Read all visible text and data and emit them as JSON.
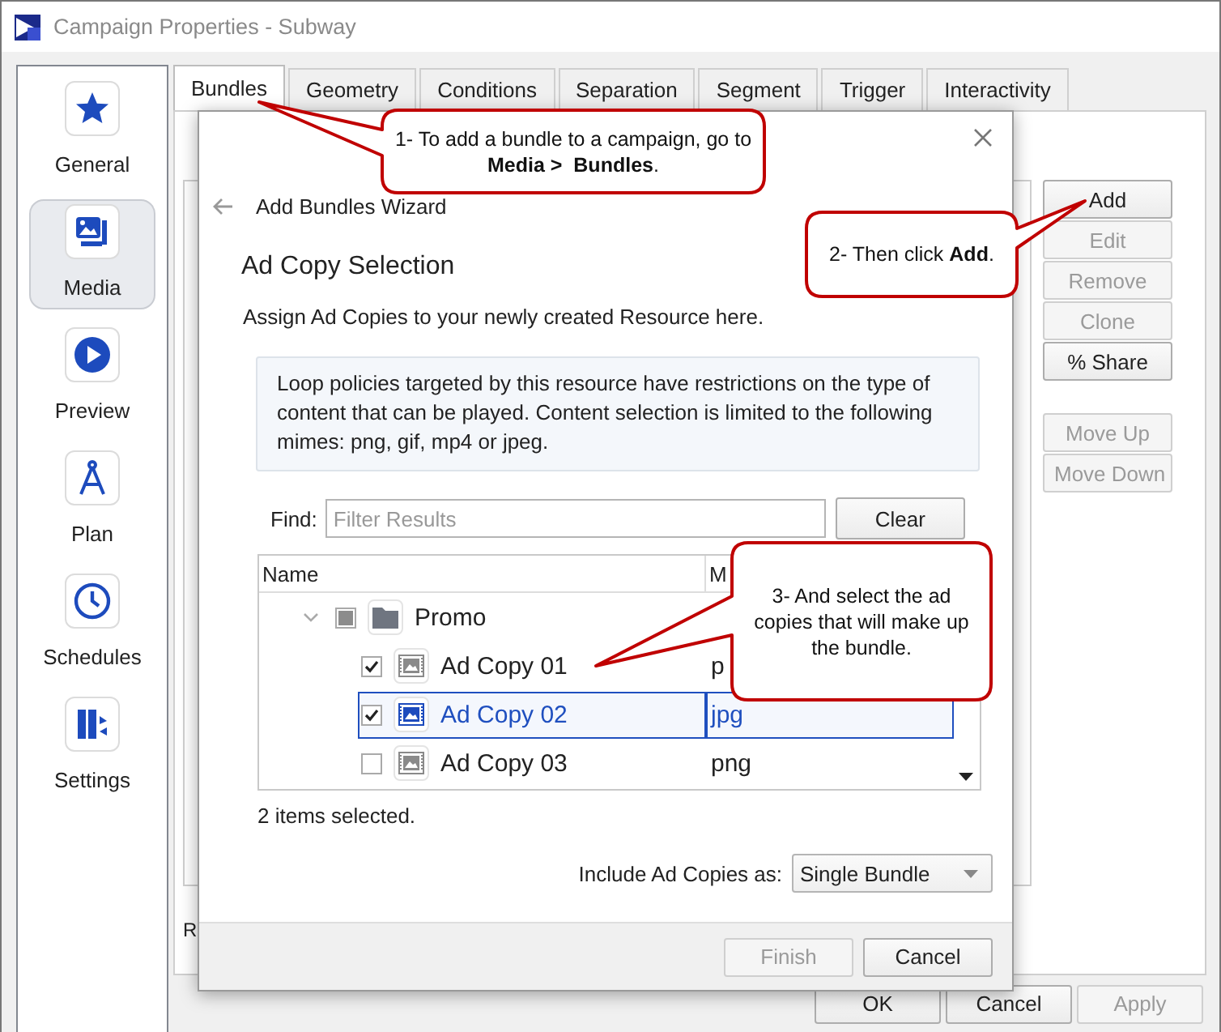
{
  "window": {
    "title": "Campaign Properties - Subway"
  },
  "sidebar": {
    "items": [
      {
        "label": "General",
        "selected": false
      },
      {
        "label": "Media",
        "selected": true
      },
      {
        "label": "Preview",
        "selected": false
      },
      {
        "label": "Plan",
        "selected": false
      },
      {
        "label": "Schedules",
        "selected": false
      },
      {
        "label": "Settings",
        "selected": false
      }
    ]
  },
  "tabs": [
    {
      "label": "Bundles",
      "selected": true
    },
    {
      "label": "Geometry",
      "selected": false
    },
    {
      "label": "Conditions",
      "selected": false
    },
    {
      "label": "Separation",
      "selected": false
    },
    {
      "label": "Segment",
      "selected": false
    },
    {
      "label": "Trigger",
      "selected": false
    },
    {
      "label": "Interactivity",
      "selected": false
    }
  ],
  "panel": {
    "label_fragment": "R"
  },
  "side_button_groups": [
    {
      "buttons": [
        {
          "label": "Add",
          "disabled": false
        },
        {
          "label": "Edit",
          "disabled": true
        },
        {
          "label": "Remove",
          "disabled": true
        },
        {
          "label": "Clone",
          "disabled": true
        },
        {
          "label": "% Share",
          "disabled": false
        }
      ]
    },
    {
      "buttons": [
        {
          "label": "Move Up",
          "disabled": true
        },
        {
          "label": "Move Down",
          "disabled": true
        }
      ]
    }
  ],
  "bottom_buttons": [
    {
      "label": "OK",
      "disabled": false
    },
    {
      "label": "Cancel",
      "disabled": false
    },
    {
      "label": "Apply",
      "disabled": true
    }
  ],
  "dialog": {
    "title": "Add Bundles Wizard",
    "heading": "Ad Copy Selection",
    "description": "Assign Ad Copies to your newly created Resource here.",
    "notice": "Loop policies targeted by this resource have restrictions on the type of content that can be played. Content selection is limited to the following mimes: png, gif, mp4 or jpeg.",
    "find": {
      "label": "Find:",
      "placeholder": "Filter Results"
    },
    "clear_button": "Clear",
    "tree": {
      "columns": [
        "Name",
        "M"
      ],
      "items": [
        {
          "name": "Promo",
          "kind": "folder",
          "expanded": true,
          "checked": false,
          "partial": true,
          "selected": false,
          "children": [
            {
              "name": "Ad Copy 01",
              "kind": "ad_copy",
              "checked": true,
              "partial": false,
              "selected": false,
              "mime": "p"
            },
            {
              "name": "Ad Copy 02",
              "kind": "ad_copy",
              "checked": true,
              "partial": false,
              "selected": true,
              "mime": "jpg"
            },
            {
              "name": "Ad Copy 03",
              "kind": "ad_copy",
              "checked": false,
              "partial": false,
              "selected": false,
              "mime": "png"
            }
          ]
        }
      ]
    },
    "status": "2 items selected.",
    "include": {
      "label": "Include Ad Copies as:",
      "value": "Single Bundle"
    },
    "buttons": [
      {
        "label": "Finish",
        "disabled": true
      },
      {
        "label": "Cancel",
        "disabled": false
      }
    ]
  },
  "callouts": [
    {
      "text": "1- To add a bundle to a campaign, go to\n**Media >  Bundles**."
    },
    {
      "text": "2- Then click **Add**."
    },
    {
      "text": "3- And select the ad copies that will make up the bundle."
    }
  ]
}
